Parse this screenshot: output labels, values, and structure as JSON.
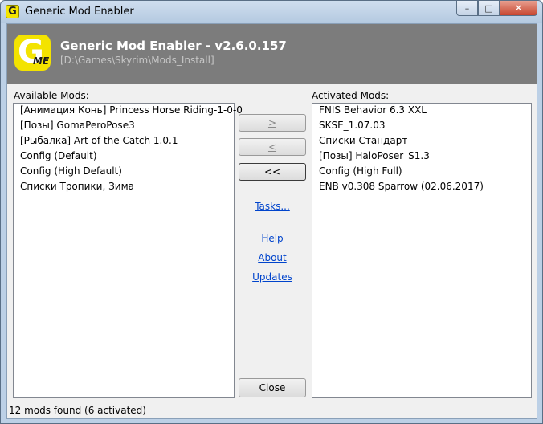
{
  "window": {
    "title": "Generic Mod Enabler",
    "icon_letter": "G",
    "controls": {
      "minimize": "–",
      "maximize": "□",
      "close": "✕"
    }
  },
  "header": {
    "logo_letter": "G",
    "logo_sub": "ME",
    "title": "Generic Mod Enabler - v2.6.0.157",
    "path": "[D:\\Games\\Skyrim\\Mods_Install]",
    "background_color": "#7c7c7c",
    "logo_color": "#f3e300"
  },
  "available": {
    "label": "Available Mods:",
    "items": [
      "[Анимация Конь] Princess Horse Riding-1-0-0",
      "[Позы] GomaPeroPose3",
      "[Рыбалка] Art of the Catch 1.0.1",
      "Config (Default)",
      "Config (High Default)",
      "Списки Тропики, Зима"
    ]
  },
  "activated": {
    "label": "Activated Mods:",
    "items": [
      "FNIS Behavior 6.3 XXL",
      "SKSE_1.07.03",
      "Списки Стандарт",
      "[Позы] HaloPoser_S1.3",
      "Config (High Full)",
      "ENB v0.308 Sparrow (02.06.2017)"
    ]
  },
  "buttons": {
    "add": ">",
    "remove": "<",
    "remove_all": "<<",
    "close": "Close"
  },
  "links": {
    "tasks": "Tasks...",
    "help": "Help",
    "about": "About",
    "updates": "Updates"
  },
  "status": {
    "text": "12 mods found (6 activated)"
  }
}
